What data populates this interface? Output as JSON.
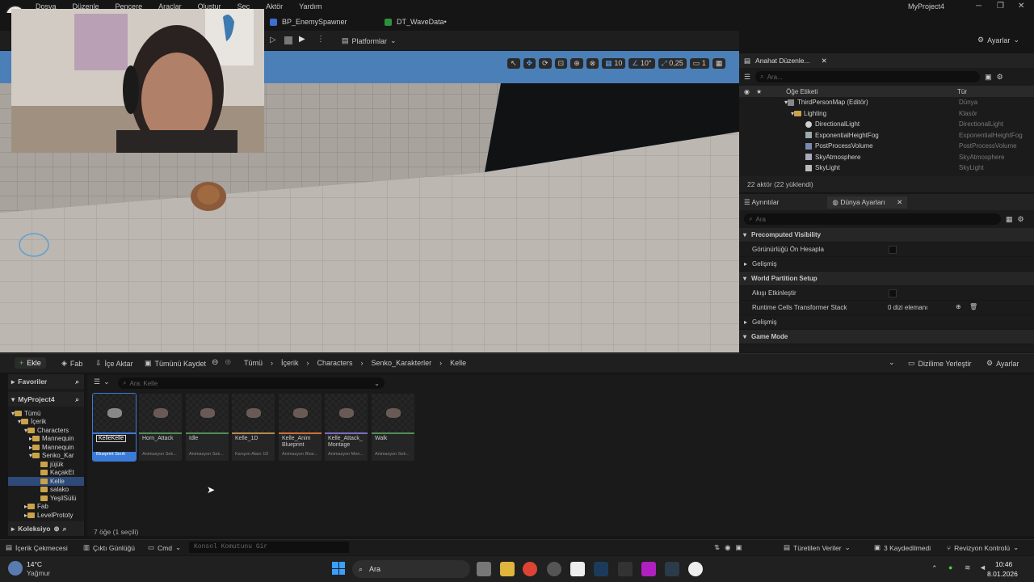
{
  "menu": [
    "Dosya",
    "Düzenle",
    "Pencere",
    "Araçlar",
    "Oluştur",
    "Seç",
    "Aktör",
    "Yardım"
  ],
  "project_name": "MyProject4",
  "doc_tabs": [
    {
      "label": "BP_EnemySpawner",
      "color": "#3b6fd0"
    },
    {
      "label": "DT_WaveData•",
      "color": "#2e8f3d"
    }
  ],
  "toolbar": {
    "platforms": "Platformlar",
    "settings": "Ayarlar"
  },
  "viewport_controls": {
    "grid": "10",
    "angle": "10°",
    "scale": "0,25",
    "camera": "1"
  },
  "outliner": {
    "tab": "Anahat Düzenle...",
    "search_placeholder": "Ara...",
    "col_label": "Öğe Etiketi",
    "col_type": "Tür",
    "rows": [
      {
        "label": "ThirdPersonMap (Editör)",
        "type": "Dünya"
      },
      {
        "label": "Lighting",
        "type": "Klasör"
      },
      {
        "label": "DirectionalLight",
        "type": "DirectionalLight"
      },
      {
        "label": "ExponentialHeightFog",
        "type": "ExponentialHeightFog"
      },
      {
        "label": "PostProcessVolume",
        "type": "PostProcessVolume"
      },
      {
        "label": "SkyAtmosphere",
        "type": "SkyAtmosphere"
      },
      {
        "label": "SkyLight",
        "type": "SkyLight"
      }
    ],
    "status": "22 aktör (22 yüklendi)"
  },
  "details": {
    "tab1": "Ayrıntılar",
    "tab2": "Dünya Ayarları",
    "search_placeholder": "Ara",
    "rows": [
      {
        "label": "Precomputed Visibility",
        "kind": "section"
      },
      {
        "label": "Görünürlüğü Ön Hesapla",
        "kind": "check",
        "value": ""
      },
      {
        "label": "Gelişmiş",
        "kind": "sub"
      },
      {
        "label": "World Partition Setup",
        "kind": "section"
      },
      {
        "label": "Akışı Etkinleştir",
        "kind": "check",
        "value": ""
      },
      {
        "label": "Runtime Cells Transformer Stack",
        "kind": "array",
        "value": "0 dizi elemanı"
      },
      {
        "label": "Gelişmiş",
        "kind": "sub"
      },
      {
        "label": "Game Mode",
        "kind": "section"
      }
    ]
  },
  "content_browser": {
    "add": "Ekle",
    "fab": "Fab",
    "import": "İçe Aktar",
    "save_all": "Tümünü Kaydet",
    "breadcrumb": [
      "Tümü",
      "İçerik",
      "Characters",
      "Senko_Karakterler",
      "Kelle"
    ],
    "dock": "Dizilime Yerleştir",
    "settings": "Ayarlar",
    "favorites": "Favoriler",
    "project": "MyProject4",
    "filter_placeholder": "Ara: Kelle",
    "tree": [
      "Tümü",
      "İçerik",
      "Characters",
      "Mannequin",
      "Mannequin",
      "Senko_Kar",
      "jüjük",
      "KaçakEt",
      "Kelle",
      "salako",
      "YeşilSülü",
      "Fab",
      "LevelPrototy"
    ],
    "collections": "Koleksiyo",
    "assets": [
      {
        "name": "KelleKelle",
        "cls": "Blueprint Sınıfı",
        "stripe": "#3b7bd8"
      },
      {
        "name": "Horn_Attack",
        "cls": "Animasyon Sek...",
        "stripe": "#4f8d56"
      },
      {
        "name": "Idle",
        "cls": "Animasyon Sek...",
        "stripe": "#4f8d56"
      },
      {
        "name": "Kelle_1D",
        "cls": "Karışım Alanı 1D",
        "stripe": "#b58a4a"
      },
      {
        "name": "Kelle_Anim Blueprint",
        "cls": "Animasyon Blue...",
        "stripe": "#c8713a"
      },
      {
        "name": "Kelle_Attack_ Montage",
        "cls": "Animasyon Mon...",
        "stripe": "#7a6dc0"
      },
      {
        "name": "Walk",
        "cls": "Animasyon Sek...",
        "stripe": "#4f8d56"
      }
    ],
    "count": "7 öğe (1 seçili)"
  },
  "statusbar": {
    "content_drawer": "İçerik Çekmecesi",
    "output_log": "Çıktı Günlüğü",
    "cmd": "Cmd",
    "console_placeholder": "Konsol Komutunu Gir",
    "derived": "Türetilen Veriler",
    "unsaved": "3 Kaydedilmedi",
    "revision": "Revizyon Kontrolü"
  },
  "taskbar": {
    "temp": "14°C",
    "weather": "Yağmur",
    "search": "Ara",
    "time": "10:46",
    "date": "8.01.2026"
  }
}
